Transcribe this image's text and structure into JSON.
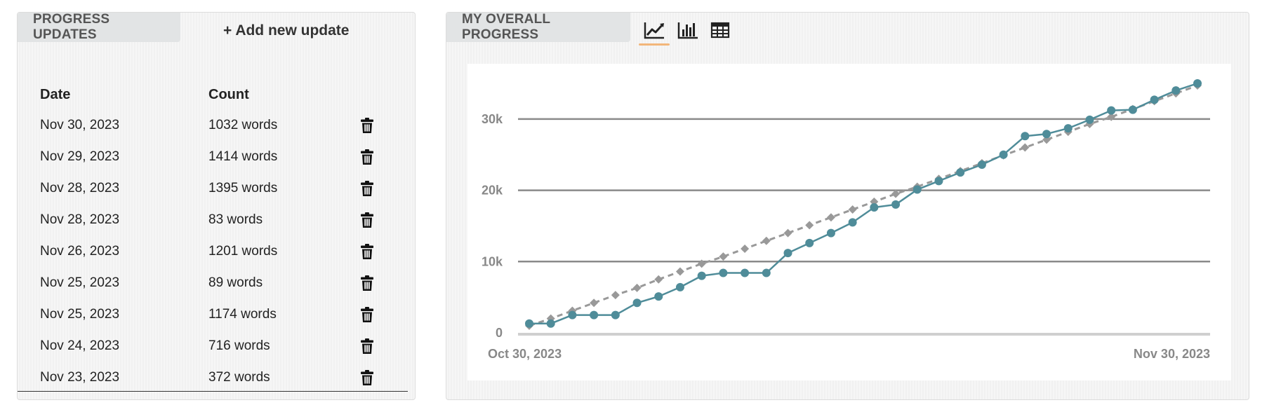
{
  "left_panel": {
    "tab_label": "PROGRESS UPDATES",
    "add_label": "+ Add new update",
    "headers": {
      "date": "Date",
      "count": "Count"
    },
    "rows": [
      {
        "date": "Nov 30, 2023",
        "count": "1032 words"
      },
      {
        "date": "Nov 29, 2023",
        "count": "1414 words"
      },
      {
        "date": "Nov 28, 2023",
        "count": "1395 words"
      },
      {
        "date": "Nov 28, 2023",
        "count": "83 words"
      },
      {
        "date": "Nov 26, 2023",
        "count": "1201 words"
      },
      {
        "date": "Nov 25, 2023",
        "count": "89 words"
      },
      {
        "date": "Nov 25, 2023",
        "count": "1174 words"
      },
      {
        "date": "Nov 24, 2023",
        "count": "716 words"
      },
      {
        "date": "Nov 23, 2023",
        "count": "372 words"
      }
    ],
    "delete_icon": "trash-icon"
  },
  "right_panel": {
    "tab_label": "MY OVERALL PROGRESS",
    "view_buttons": [
      {
        "icon": "line-chart-icon",
        "active": true
      },
      {
        "icon": "bar-chart-icon",
        "active": false
      },
      {
        "icon": "table-icon",
        "active": false
      }
    ]
  },
  "colors": {
    "actual_line": "#4f8c99",
    "target_line": "#999999",
    "active_underline": "#f2b67a",
    "tab_bg": "#e2e4e5"
  },
  "chart_data": {
    "type": "line",
    "title": "",
    "xlabel": "",
    "ylabel": "",
    "x_tick_labels": [
      "Oct 30, 2023",
      "Nov 30, 2023"
    ],
    "y_ticks": [
      0,
      10000,
      20000,
      30000
    ],
    "y_tick_labels": [
      "0",
      "10k",
      "20k",
      "30k"
    ],
    "ylim": [
      0,
      35000
    ],
    "grid": true,
    "legend": "none",
    "x": [
      "Oct 30, 2023",
      "Oct 31, 2023",
      "Nov 1, 2023",
      "Nov 2, 2023",
      "Nov 3, 2023",
      "Nov 4, 2023",
      "Nov 5, 2023",
      "Nov 6, 2023",
      "Nov 7, 2023",
      "Nov 8, 2023",
      "Nov 9, 2023",
      "Nov 10, 2023",
      "Nov 11, 2023",
      "Nov 12, 2023",
      "Nov 13, 2023",
      "Nov 14, 2023",
      "Nov 15, 2023",
      "Nov 16, 2023",
      "Nov 17, 2023",
      "Nov 18, 2023",
      "Nov 19, 2023",
      "Nov 20, 2023",
      "Nov 21, 2023",
      "Nov 22, 2023",
      "Nov 23, 2023",
      "Nov 24, 2023",
      "Nov 25, 2023",
      "Nov 26, 2023",
      "Nov 27, 2023",
      "Nov 28, 2023",
      "Nov 29, 2023",
      "Nov 30, 2023"
    ],
    "series": [
      {
        "style": "solid-circle",
        "values": [
          1300,
          1300,
          2500,
          2500,
          2500,
          4200,
          5100,
          6400,
          8000,
          8400,
          8400,
          8400,
          11200,
          12600,
          14000,
          15500,
          17600,
          18000,
          20100,
          21300,
          22500,
          23600,
          25000,
          27600,
          27900,
          28700,
          29900,
          31200,
          31300,
          32700,
          34000,
          35000
        ]
      },
      {
        "style": "dashed-diamond",
        "values": [
          1000,
          2000,
          3100,
          4200,
          5300,
          6300,
          7500,
          8600,
          9700,
          10700,
          11800,
          12900,
          14000,
          15100,
          16200,
          17300,
          18400,
          19500,
          20500,
          21600,
          22700,
          23800,
          24900,
          26000,
          27100,
          28200,
          29300,
          30300,
          31400,
          32500,
          33600,
          34700
        ]
      }
    ]
  }
}
